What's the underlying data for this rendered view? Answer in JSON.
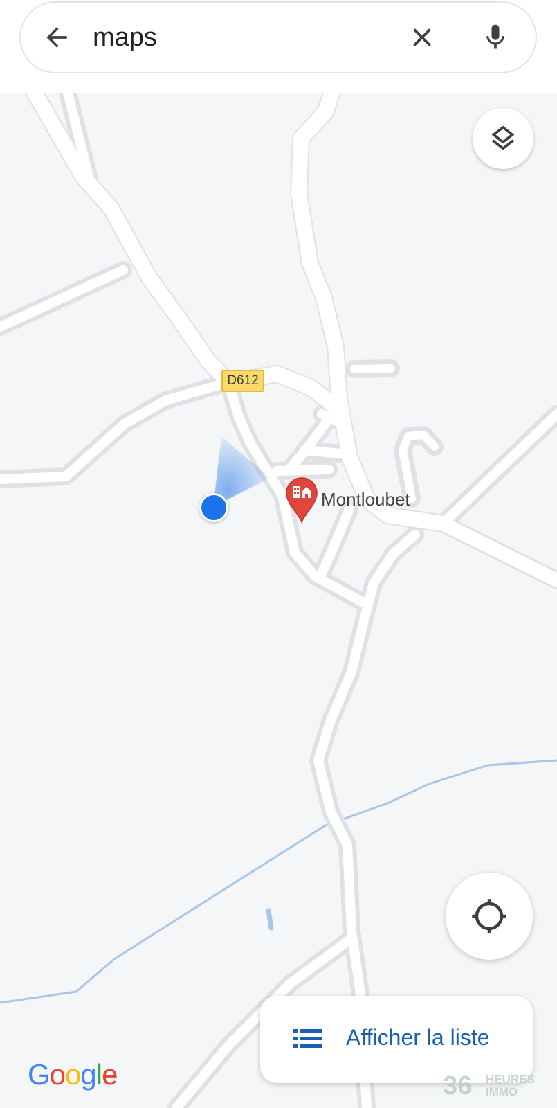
{
  "search": {
    "query": "maps",
    "back_icon": "arrow-left-icon",
    "clear_icon": "close-icon",
    "mic_icon": "microphone-icon"
  },
  "map": {
    "layers_icon": "layers-icon",
    "road_shield": "D612",
    "place": {
      "name": "Montloubet",
      "icon": "home-pin-icon",
      "pin_color": "#e0463c"
    },
    "my_location_color": "#1a73e8",
    "locate_icon": "crosshair-icon"
  },
  "list_button": {
    "label": "Afficher la liste",
    "icon": "list-icon",
    "color": "#1a5fb4"
  },
  "branding": {
    "logo": "Google",
    "watermark_number": "36",
    "watermark_top": "HEURES",
    "watermark_bottom": "IMMO"
  }
}
